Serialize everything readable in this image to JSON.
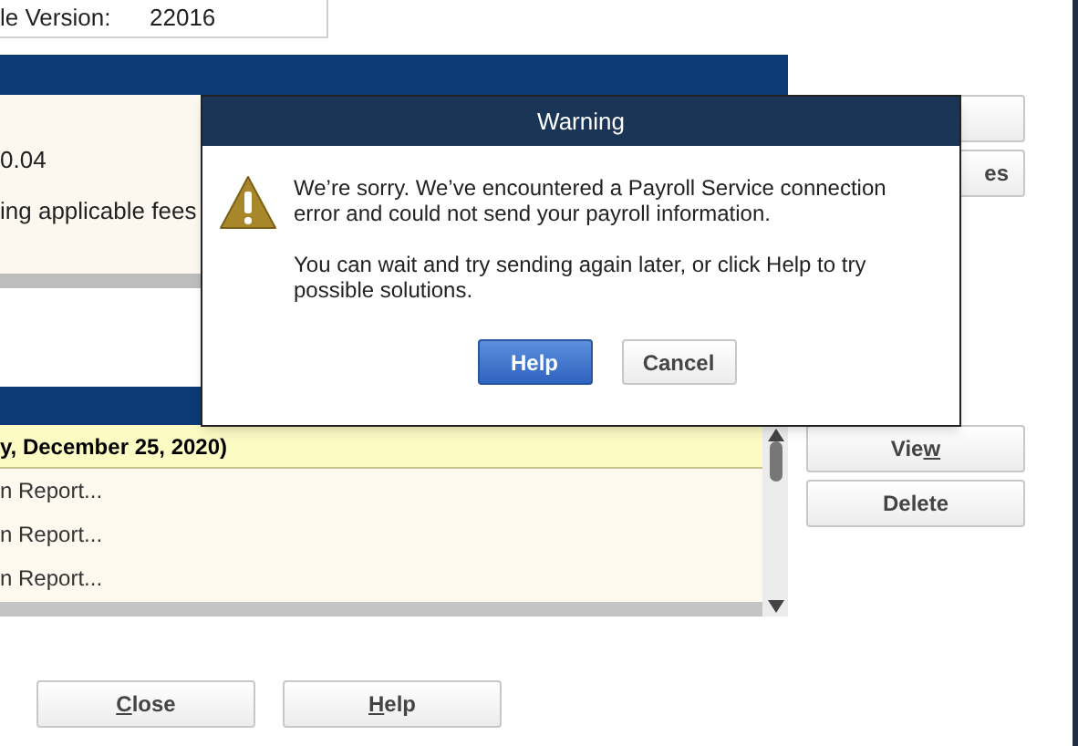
{
  "version_field": {
    "label": "le Version:",
    "value": "22016"
  },
  "upper_panel": {
    "lines": [
      "0.04",
      "ing applicable fees"
    ]
  },
  "upper_buttons": [
    {
      "kind": "button"
    },
    {
      "kind": "button",
      "label": "es"
    }
  ],
  "list": {
    "rows": [
      {
        "text": "y, December 25, 2020)",
        "selected": true
      },
      {
        "text": "n Report...",
        "selected": false
      },
      {
        "text": "n Report...",
        "selected": false
      },
      {
        "text": "n Report...",
        "selected": false
      }
    ]
  },
  "side_buttons": [
    {
      "pre": "Vie",
      "key": "w"
    },
    {
      "pre": "Delete"
    }
  ],
  "bottom_buttons": [
    {
      "key": "C",
      "post": "lose"
    },
    {
      "key": "H",
      "post": "elp"
    }
  ],
  "dialog": {
    "title": "Warning",
    "messages": [
      "We’re sorry. We’ve encountered a Payroll Service connection error and could not send your payroll information.",
      "You can wait and try sending again later, or click Help to try possible solutions."
    ],
    "buttons": [
      {
        "label": "Help",
        "primary": true
      },
      {
        "label": "Cancel",
        "primary": false
      }
    ]
  }
}
